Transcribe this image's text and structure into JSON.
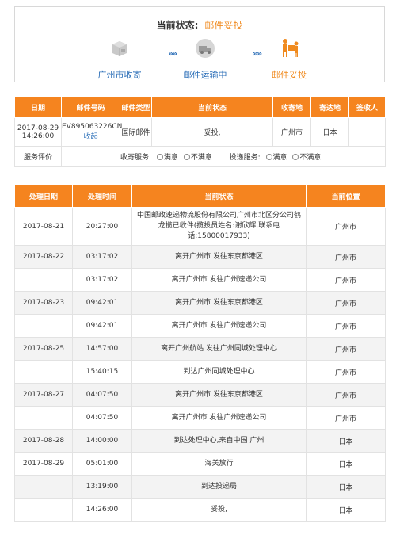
{
  "status": {
    "label": "当前状态:",
    "value": "邮件妥投"
  },
  "steps": [
    {
      "label": "广州市收寄"
    },
    {
      "label": "邮件运输中"
    },
    {
      "label": "邮件妥投"
    }
  ],
  "arrows": "»»",
  "mail": {
    "headers": [
      "日期",
      "邮件号码",
      "邮件类型",
      "当前状态",
      "收寄地",
      "寄达地",
      "签收人"
    ],
    "date": "2017-08-29 14:26:00",
    "number": "EV895063226CN",
    "collapse_link": "收起",
    "type": "国际邮件",
    "state": "妥投,",
    "origin": "广州市",
    "destination": "日本",
    "signer": ""
  },
  "evaluation": {
    "label": "服务评价",
    "pickup_label": "收寄服务:",
    "delivery_label": "投递服务:",
    "satisfied": "满意",
    "unsatisfied": "不满意"
  },
  "tracking": {
    "headers": [
      "处理日期",
      "处理时间",
      "当前状态",
      "当前位置"
    ],
    "rows": [
      {
        "date": "2017-08-21",
        "time": "20:27:00",
        "status": "中国邮政速递物流股份有限公司广州市北区分公司鹤龙揽已收件(揽投员姓名:谢欣辉,联系电话:15800017933)",
        "location": "广州市"
      },
      {
        "date": "2017-08-22",
        "time": "03:17:02",
        "status": "离开广州市 发往东京都港区",
        "location": "广州市"
      },
      {
        "date": "",
        "time": "03:17:02",
        "status": "离开广州市 发往广州速递公司",
        "location": "广州市"
      },
      {
        "date": "2017-08-23",
        "time": "09:42:01",
        "status": "离开广州市 发往东京都港区",
        "location": "广州市"
      },
      {
        "date": "",
        "time": "09:42:01",
        "status": "离开广州市 发往广州速递公司",
        "location": "广州市"
      },
      {
        "date": "2017-08-25",
        "time": "14:57:00",
        "status": "离开广州航站 发往广州同城处理中心",
        "location": "广州市"
      },
      {
        "date": "",
        "time": "15:40:15",
        "status": "到达广州同城处理中心",
        "location": "广州市"
      },
      {
        "date": "2017-08-27",
        "time": "04:07:50",
        "status": "离开广州市 发往东京都港区",
        "location": "广州市"
      },
      {
        "date": "",
        "time": "04:07:50",
        "status": "离开广州市 发往广州速递公司",
        "location": "广州市"
      },
      {
        "date": "2017-08-28",
        "time": "14:00:00",
        "status": "到达处理中心,来自中国 广州",
        "location": "日本"
      },
      {
        "date": "2017-08-29",
        "time": "05:01:00",
        "status": "海关放行",
        "location": "日本"
      },
      {
        "date": "",
        "time": "13:19:00",
        "status": "到达投递局",
        "location": "日本"
      },
      {
        "date": "",
        "time": "14:26:00",
        "status": "妥投,",
        "location": "日本"
      }
    ]
  },
  "colors": {
    "accent": "#f5841f",
    "link": "#2c6fb8"
  }
}
